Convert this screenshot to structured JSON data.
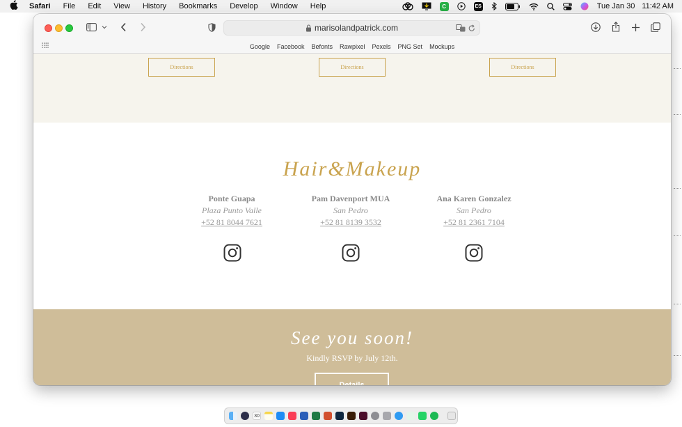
{
  "menubar": {
    "app_name": "Safari",
    "menus": [
      "File",
      "Edit",
      "View",
      "History",
      "Bookmarks",
      "Develop",
      "Window",
      "Help"
    ],
    "status_icons": [
      "creative-cloud-icon",
      "display-icon",
      "clipboard-icon",
      "play-icon",
      "es-input-icon",
      "bluetooth-icon",
      "battery-icon",
      "wifi-icon",
      "search-icon",
      "control-center-icon",
      "siri-icon"
    ],
    "date": "Tue Jan 30",
    "time": "11:42 AM"
  },
  "browser": {
    "address": "marisolandpatrick.com",
    "favorites": [
      "Google",
      "Facebook",
      "Befonts",
      "Rawpixel",
      "Pexels",
      "PNG Set",
      "Mockups"
    ]
  },
  "page": {
    "directions_label": "Directions",
    "hair_title": "Hair&Makeup",
    "vendors": [
      {
        "name": "Ponte Guapa",
        "location": "Plaza Punto Valle",
        "phone": "+52 81 8044 7621"
      },
      {
        "name": "Pam Davenport MUA",
        "location": "San Pedro",
        "phone": "+52 81 8139 3532"
      },
      {
        "name": "Ana Karen Gonzalez",
        "location": "San Pedro",
        "phone": "+52 81 2361 7104"
      }
    ],
    "soon_title": "See you soon!",
    "soon_subtitle": "Kindly RSVP by July 12th.",
    "details_label": "Details"
  },
  "dock": {
    "calendar_day": "30",
    "apps": [
      "finder",
      "launchpad",
      "calendar",
      "notes",
      "app-store",
      "music",
      "word",
      "excel",
      "powerpoint",
      "photoshop",
      "illustrator",
      "indesign",
      "settings",
      "utilities",
      "safari",
      "grammarly",
      "whatsapp",
      "spotify",
      "trash"
    ]
  },
  "colors": {
    "gold": "#c9a34e",
    "beige": "#f6f4ed",
    "tan": "#cfbd99"
  }
}
